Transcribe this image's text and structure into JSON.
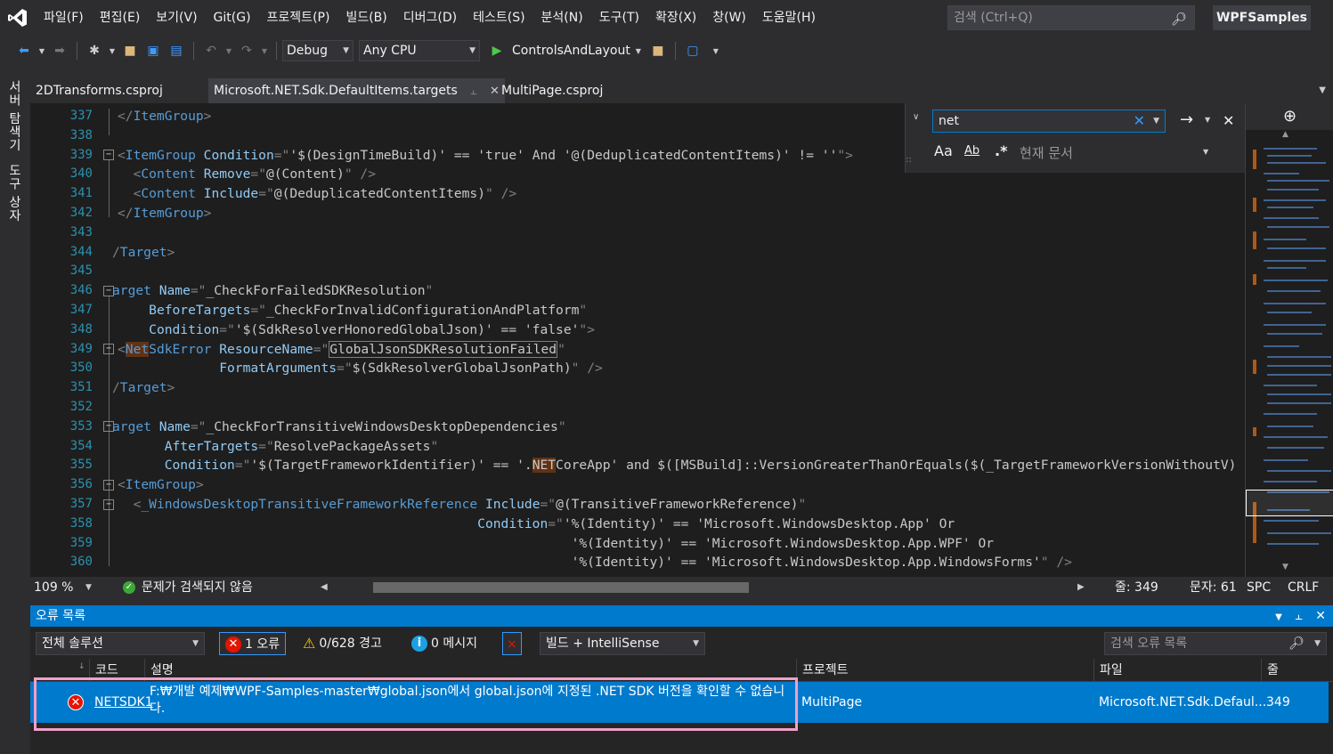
{
  "menubar": {
    "items": [
      "파일(F)",
      "편집(E)",
      "보기(V)",
      "Git(G)",
      "프로젝트(P)",
      "빌드(B)",
      "디버그(D)",
      "테스트(S)",
      "분석(N)",
      "도구(T)",
      "확장(X)",
      "창(W)",
      "도움말(H)"
    ],
    "search_placeholder": "검색 (Ctrl+Q)",
    "solution_name": "WPFSamples"
  },
  "toolbar": {
    "config": "Debug",
    "platform": "Any CPU",
    "startup_project": "ControlsAndLayout"
  },
  "left_strip": {
    "tab1": "서버 탐색기",
    "tab2": "도구 상자"
  },
  "doctabs": {
    "tab1": "2DTransforms.csproj",
    "tab2": "Microsoft.NET.Sdk.DefaultItems.targets",
    "tab3": "MultiPage.csproj"
  },
  "find": {
    "query": "net",
    "scope": "현재 문서",
    "match_case_label": "Aa",
    "whole_word_label": "Ab",
    "regex_label": ".*"
  },
  "editor": {
    "line_numbers": [
      "337",
      "338",
      "339",
      "340",
      "341",
      "342",
      "343",
      "344",
      "345",
      "346",
      "347",
      "348",
      "349",
      "350",
      "351",
      "352",
      "353",
      "354",
      "355",
      "356",
      "357",
      "358",
      "359",
      "360"
    ]
  },
  "editor_status": {
    "zoom": "109 %",
    "issues": "문제가 검색되지 않음",
    "line": "줄: 349",
    "col": "문자: 61",
    "whitespace": "SPC",
    "eol": "CRLF"
  },
  "error_list": {
    "title": "오류 목록",
    "scope": "전체 솔루션",
    "errors": "1 오류",
    "warnings": "0/628 경고",
    "messages": "0 메시지",
    "source": "빌드 + IntelliSense",
    "search_placeholder": "검색 오류 목록",
    "columns": {
      "code": "코드",
      "desc": "설명",
      "project": "프로젝트",
      "file": "파일",
      "line": "줄"
    },
    "rows": [
      {
        "code": "NETSDK1",
        "desc": "F:₩개발 예제₩WPF-Samples-master₩global.json에서 global.json에 지정된 .NET SDK 버전을 확인할 수 없습니다.",
        "project": "MultiPage",
        "file": "Microsoft.NET.Sdk.Defaul...",
        "line": "349"
      }
    ]
  }
}
